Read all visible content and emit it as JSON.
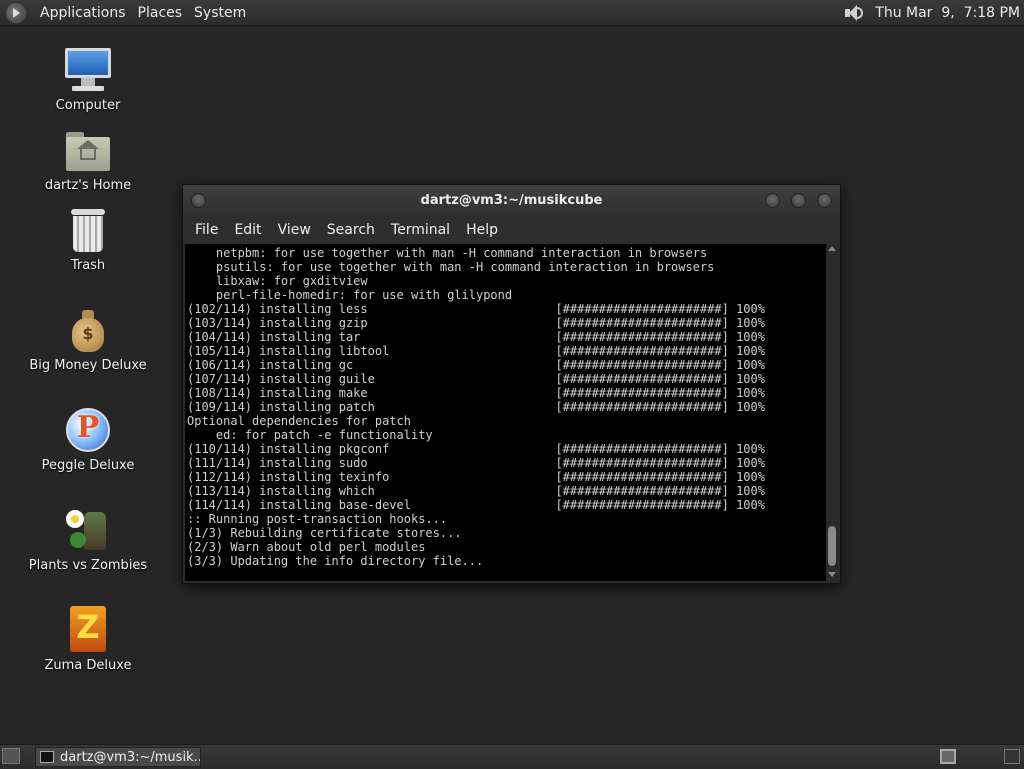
{
  "top_panel": {
    "menus": [
      "Applications",
      "Places",
      "System"
    ],
    "clock": "Thu Mar  9,  7:18 PM"
  },
  "desktop": {
    "icons": [
      {
        "label": "Computer",
        "icon": "computer-icon"
      },
      {
        "label": "dartz's Home",
        "icon": "home-folder-icon"
      },
      {
        "label": "Trash",
        "icon": "trash-icon"
      },
      {
        "label": "Big Money Deluxe",
        "icon": "money-bag-icon"
      },
      {
        "label": "Peggle Deluxe",
        "icon": "peggle-icon"
      },
      {
        "label": "Plants vs Zombies",
        "icon": "plants-vs-zombies-icon"
      },
      {
        "label": "Zuma Deluxe",
        "icon": "zuma-icon"
      }
    ]
  },
  "terminal": {
    "title": "dartz@vm3:~/musikcube",
    "menu": [
      "File",
      "Edit",
      "View",
      "Search",
      "Terminal",
      "Help"
    ],
    "lines": [
      "    netpbm: for use together with man -H command interaction in browsers",
      "    psutils: for use together with man -H command interaction in browsers",
      "    libxaw: for gxditview",
      "    perl-file-homedir: for use with glilypond",
      "(102/114) installing less                          [######################] 100%",
      "(103/114) installing gzip                          [######################] 100%",
      "(104/114) installing tar                           [######################] 100%",
      "(105/114) installing libtool                       [######################] 100%",
      "(106/114) installing gc                            [######################] 100%",
      "(107/114) installing guile                         [######################] 100%",
      "(108/114) installing make                          [######################] 100%",
      "(109/114) installing patch                         [######################] 100%",
      "Optional dependencies for patch",
      "    ed: for patch -e functionality",
      "(110/114) installing pkgconf                       [######################] 100%",
      "(111/114) installing sudo                          [######################] 100%",
      "(112/114) installing texinfo                       [######################] 100%",
      "(113/114) installing which                         [######################] 100%",
      "(114/114) installing base-devel                    [######################] 100%",
      ":: Running post-transaction hooks...",
      "(1/3) Rebuilding certificate stores...",
      "(2/3) Warn about old perl modules",
      "(3/3) Updating the info directory file..."
    ]
  },
  "bottom_panel": {
    "task": "dartz@vm3:~/musik..."
  }
}
